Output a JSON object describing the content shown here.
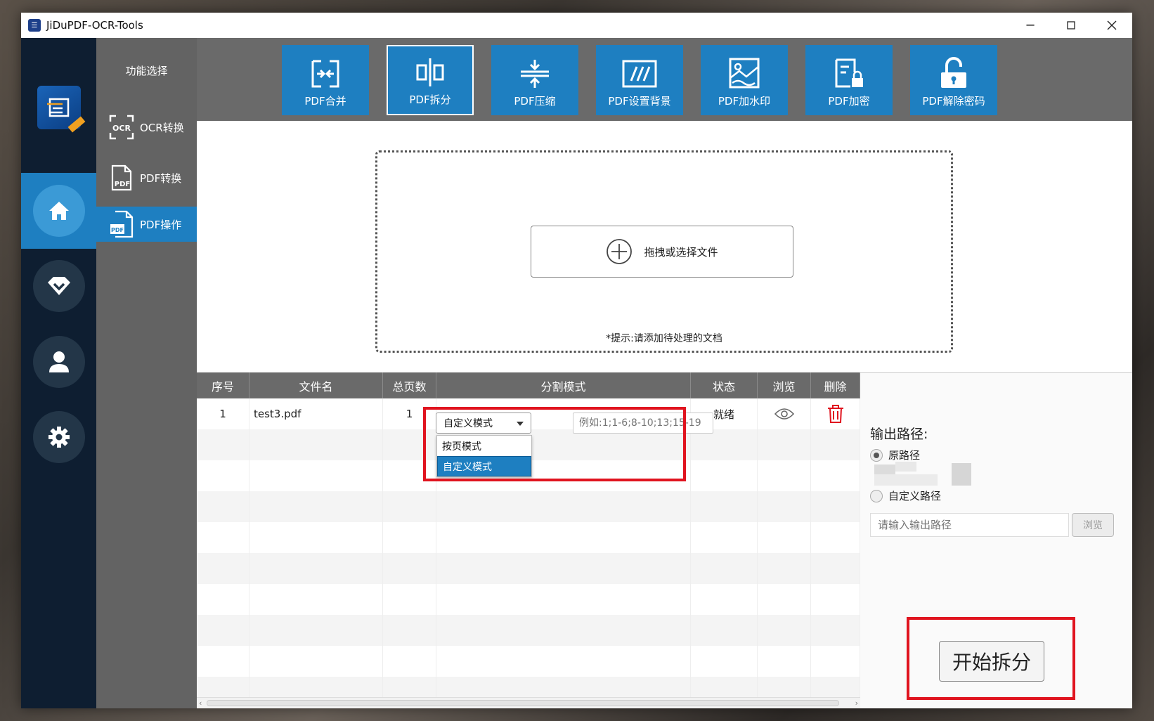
{
  "window": {
    "title": "JiDuPDF-OCR-Tools"
  },
  "menu": {
    "title": "功能选择",
    "items": [
      {
        "label": "OCR转换"
      },
      {
        "label": "PDF转换"
      },
      {
        "label": "PDF操作"
      }
    ]
  },
  "toolbar": {
    "tools": [
      {
        "label": "PDF合并"
      },
      {
        "label": "PDF拆分"
      },
      {
        "label": "PDF压缩"
      },
      {
        "label": "PDF设置背景"
      },
      {
        "label": "PDF加水印"
      },
      {
        "label": "PDF加密"
      },
      {
        "label": "PDF解除密码"
      }
    ]
  },
  "drop": {
    "button_label": "拖拽或选择文件",
    "hint": "*提示:请添加待处理的文档"
  },
  "table": {
    "headers": [
      "序号",
      "文件名",
      "总页数",
      "分割模式",
      "状态",
      "浏览",
      "删除"
    ],
    "rows": [
      {
        "index": "1",
        "filename": "test3.pdf",
        "pages": "1",
        "mode": "自定义模式",
        "range_placeholder": "例如:1;1-6;8-10;13;15-19",
        "status": "就绪"
      }
    ],
    "mode_options": [
      "按页模式",
      "自定义模式"
    ]
  },
  "output": {
    "label": "输出路径:",
    "option_original": "原路径",
    "option_custom": "自定义路径",
    "path_placeholder": "请输入输出路径",
    "browse_label": "浏览",
    "start_label": "开始拆分"
  },
  "colors": {
    "accent": "#1e7fc1",
    "highlight_box": "#e0141f",
    "sidebar": "#0e1e31",
    "menu_bg": "#636363"
  }
}
